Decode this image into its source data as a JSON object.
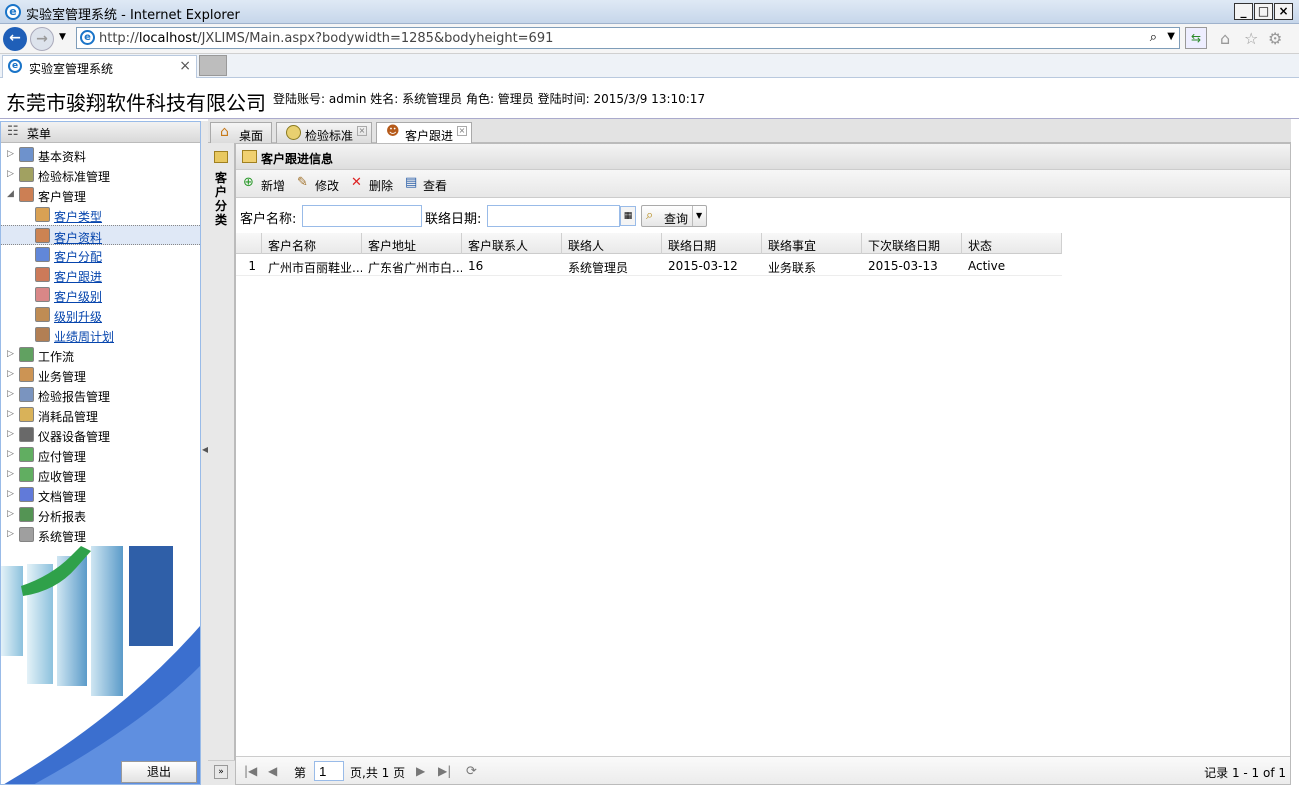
{
  "browser": {
    "window_title": "实验室管理系统 - Internet Explorer",
    "url_prefix": "http://",
    "url_host": "localhost",
    "url_path": "/JXLIMS/Main.aspx?bodywidth=1285&bodyheight=691",
    "tab_title": "实验室管理系统",
    "tab_close": "×",
    "win_min": "_",
    "win_max": "□",
    "win_close": "×"
  },
  "header": {
    "company": "东莞市骏翔软件科技有限公司",
    "login_info": "登陆账号: admin 姓名: 系统管理员 角色: 管理员 登陆时间: 2015/3/9 13:10:17"
  },
  "sidebar": {
    "title": "菜单",
    "items": [
      {
        "label": "基本资料",
        "level": 0,
        "expanded": false
      },
      {
        "label": "检验标准管理",
        "level": 0,
        "expanded": false
      },
      {
        "label": "客户管理",
        "level": 0,
        "expanded": true
      },
      {
        "label": "客户类型",
        "level": 1
      },
      {
        "label": "客户资料",
        "level": 1,
        "selected": true
      },
      {
        "label": "客户分配",
        "level": 1
      },
      {
        "label": "客户跟进",
        "level": 1
      },
      {
        "label": "客户级别",
        "level": 1
      },
      {
        "label": "级别升级",
        "level": 1
      },
      {
        "label": "业绩周计划",
        "level": 1
      },
      {
        "label": "工作流",
        "level": 0,
        "expanded": false
      },
      {
        "label": "业务管理",
        "level": 0,
        "expanded": false
      },
      {
        "label": "检验报告管理",
        "level": 0,
        "expanded": false
      },
      {
        "label": "消耗品管理",
        "level": 0,
        "expanded": false
      },
      {
        "label": "仪器设备管理",
        "level": 0,
        "expanded": false
      },
      {
        "label": "应付管理",
        "level": 0,
        "expanded": false
      },
      {
        "label": "应收管理",
        "level": 0,
        "expanded": false
      },
      {
        "label": "文档管理",
        "level": 0,
        "expanded": false
      },
      {
        "label": "分析报表",
        "level": 0,
        "expanded": false
      },
      {
        "label": "系统管理",
        "level": 0,
        "expanded": false
      }
    ],
    "logout": "退出"
  },
  "tabs": [
    {
      "label": "桌面",
      "closable": false,
      "active": false
    },
    {
      "label": "检验标准",
      "closable": true,
      "active": false
    },
    {
      "label": "客户跟进",
      "closable": true,
      "active": true
    }
  ],
  "category_panel": {
    "label": "客户分类"
  },
  "panel": {
    "title": "客户跟进信息"
  },
  "toolbar": {
    "add": "新增",
    "edit": "修改",
    "delete": "删除",
    "view": "查看"
  },
  "search": {
    "name_label": "客户名称:",
    "name_value": "",
    "date_label": "联络日期:",
    "date_value": "",
    "query": "查询"
  },
  "grid": {
    "columns": [
      "客户名称",
      "客户地址",
      "客户联系人",
      "联络人",
      "联络日期",
      "联络事宜",
      "下次联络日期",
      "状态"
    ],
    "rows": [
      {
        "index": "1",
        "cells": [
          "广州市百丽鞋业...",
          "广东省广州市白...",
          "16",
          "系统管理员",
          "2015-03-12",
          "业务联系",
          "2015-03-13",
          "Active"
        ]
      }
    ]
  },
  "pager": {
    "page_label": "第",
    "page_value": "1",
    "total": "页,共 1 页",
    "record_info": "记录 1 - 1 of 1"
  }
}
